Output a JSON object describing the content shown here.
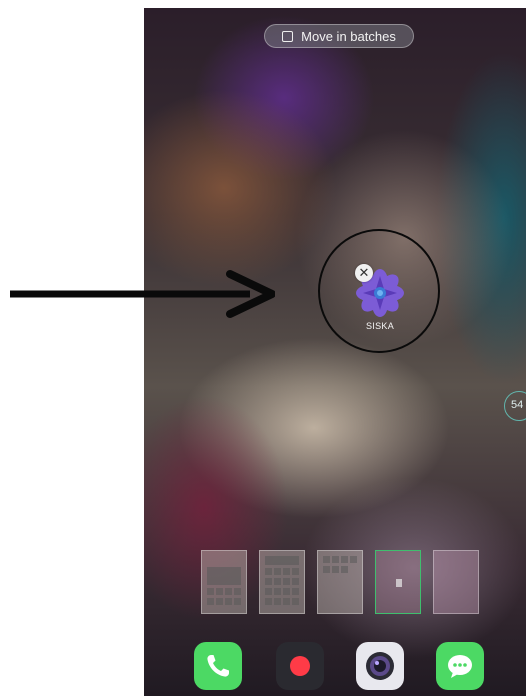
{
  "toolbar": {
    "move_in_batches_label": "Move in batches"
  },
  "app": {
    "label": "SISKA",
    "remove_glyph": "✕",
    "icon": "siska-flower-icon"
  },
  "page_indicator": {
    "text": "54"
  },
  "widget_thumbnails": [
    {
      "icon": "widget-4x4-thumbnail"
    },
    {
      "icon": "widget-grid-thumbnail"
    },
    {
      "icon": "widget-small-grid-thumbnail"
    },
    {
      "icon": "widget-1x1-thumbnail",
      "selected": true
    },
    {
      "icon": "widget-empty-thumbnail"
    }
  ],
  "dock": [
    {
      "icon": "phone-icon",
      "color": "#4cd964"
    },
    {
      "icon": "record-icon",
      "color": "#ff3b47"
    },
    {
      "icon": "camera-icon",
      "color": "#e8e8ee"
    },
    {
      "icon": "message-icon",
      "color": "#4cd964"
    }
  ],
  "annotations": {
    "arrow": "arrow-annotation",
    "circle": "circle-annotation"
  },
  "colors": {
    "accent_green": "#3fbf6e",
    "indicator_teal": "#64c8be",
    "annotation_black": "#0a0a0a"
  }
}
